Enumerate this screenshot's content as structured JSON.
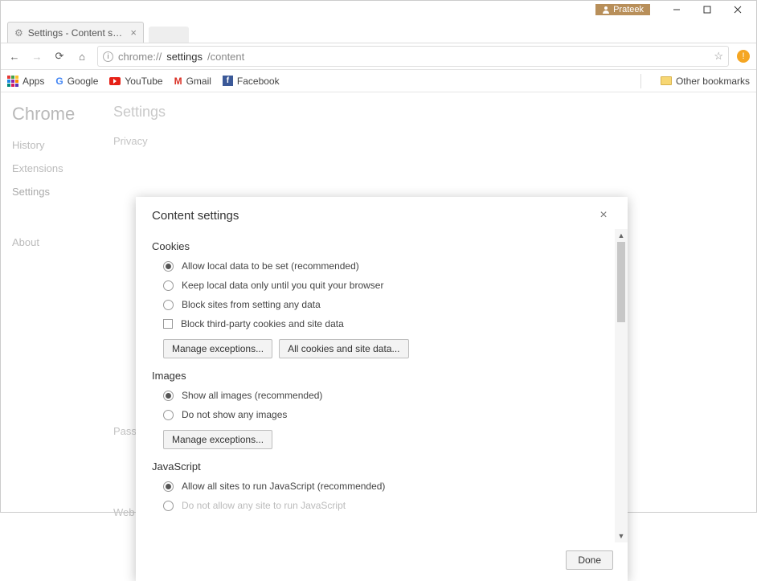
{
  "window": {
    "user_badge": "Prateek"
  },
  "tab": {
    "title": "Settings - Content settings"
  },
  "toolbar": {
    "url_prefix": "chrome://",
    "url_bold": "settings",
    "url_rest": "/content"
  },
  "bookmarks_bar": {
    "apps": "Apps",
    "items": [
      {
        "label": "Google"
      },
      {
        "label": "YouTube"
      },
      {
        "label": "Gmail"
      },
      {
        "label": "Facebook"
      }
    ],
    "other": "Other bookmarks"
  },
  "background_page": {
    "brand": "Chrome",
    "nav": [
      "History",
      "Extensions",
      "Settings",
      "About"
    ],
    "main_title": "Settings",
    "sections": [
      "Privacy",
      "Passwords",
      "Web content"
    ]
  },
  "modal": {
    "title": "Content settings",
    "done": "Done",
    "cookies": {
      "title": "Cookies",
      "opt1": "Allow local data to be set (recommended)",
      "opt2": "Keep local data only until you quit your browser",
      "opt3": "Block sites from setting any data",
      "chk1": "Block third-party cookies and site data",
      "btn1": "Manage exceptions...",
      "btn2": "All cookies and site data..."
    },
    "images": {
      "title": "Images",
      "opt1": "Show all images (recommended)",
      "opt2": "Do not show any images",
      "btn1": "Manage exceptions..."
    },
    "javascript": {
      "title": "JavaScript",
      "opt1": "Allow all sites to run JavaScript (recommended)",
      "opt2": "Do not allow any site to run JavaScript"
    }
  }
}
